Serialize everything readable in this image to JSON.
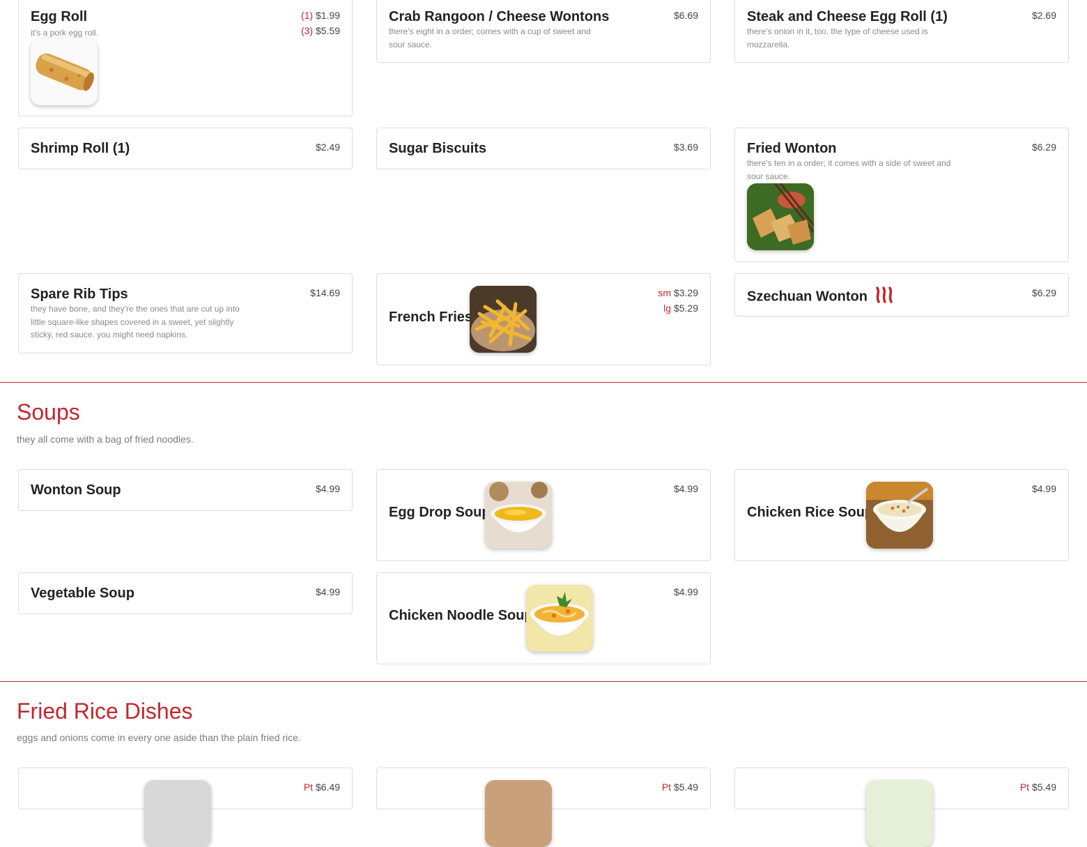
{
  "items": {
    "egg_roll": {
      "name": "Egg Roll",
      "desc": "it's a pork egg roll.",
      "prices": [
        {
          "label": "(1)",
          "price": "$1.99"
        },
        {
          "label": "(3)",
          "price": "$5.59"
        }
      ]
    },
    "crab_rangoon": {
      "name": "Crab Rangoon / Cheese Wontons",
      "desc": "there's eight in a order; comes with a cup of sweet and sour sauce.",
      "price": "$6.69"
    },
    "steak_cheese_roll": {
      "name": "Steak and Cheese Egg Roll (1)",
      "desc": "there's onion in it, too. the type of cheese used is mozzarella.",
      "price": "$2.69"
    },
    "shrimp_roll": {
      "name": "Shrimp Roll (1)",
      "price": "$2.49"
    },
    "sugar_biscuits": {
      "name": "Sugar Biscuits",
      "price": "$3.69"
    },
    "fried_wonton": {
      "name": "Fried Wonton",
      "desc": "there's ten in a order; it comes with a side of sweet and sour sauce.",
      "price": "$6.29"
    },
    "spare_rib_tips": {
      "name": "Spare Rib Tips",
      "desc": "they have bone, and they're the ones that are cut up into little square-like shapes covered in a sweet, yet slightly sticky, red sauce. you might need napkins.",
      "price": "$14.69"
    },
    "french_fries": {
      "name": "French Fries",
      "prices": [
        {
          "label": "sm",
          "price": "$3.29"
        },
        {
          "label": "lg",
          "price": "$5.29"
        }
      ]
    },
    "szechuan_wonton": {
      "name": "Szechuan Wonton",
      "price": "$6.29"
    },
    "wonton_soup": {
      "name": "Wonton Soup",
      "price": "$4.99"
    },
    "egg_drop_soup": {
      "name": "Egg Drop Soup",
      "price": "$4.99"
    },
    "chicken_rice_soup": {
      "name": "Chicken Rice Soup",
      "price": "$4.99"
    },
    "vegetable_soup": {
      "name": "Vegetable Soup",
      "price": "$4.99"
    },
    "chicken_noodle_soup": {
      "name": "Chicken Noodle Soup",
      "price": "$4.99"
    }
  },
  "sections": {
    "soups": {
      "title": "Soups",
      "subtitle": "they all come with a bag of fried noodles."
    },
    "fried_rice": {
      "title": "Fried Rice Dishes",
      "subtitle": "eggs and onions come in every one aside than the plain fried rice.",
      "partial_prices": [
        {
          "label": "Pt",
          "price": "$6.49"
        },
        {
          "label": "Pt",
          "price": "$5.49"
        },
        {
          "label": "Pt",
          "price": "$5.49"
        }
      ]
    }
  },
  "icons": {
    "spicy": "chili-pepper-icon"
  },
  "colors": {
    "accent": "#c1272d",
    "border": "#dcdcdc",
    "text": "#222222",
    "muted": "#8a8a8a"
  }
}
